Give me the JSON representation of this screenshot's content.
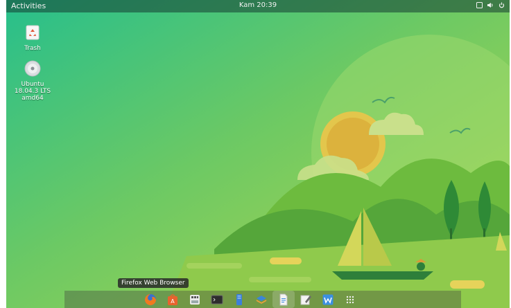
{
  "topbar": {
    "activities_label": "Activities",
    "clock_text": "Kam 20:39",
    "tray_icons": [
      "window-icon",
      "volume-icon",
      "power-icon"
    ]
  },
  "desktop": {
    "trash_label": "Trash",
    "disc_label_line1": "Ubuntu",
    "disc_label_line2": "18.04.3 LTS",
    "disc_label_line3": "amd64"
  },
  "dock": {
    "tooltip": "Firefox Web Browser",
    "items": [
      "firefox-icon",
      "software-store-icon",
      "app-3-icon",
      "terminal-icon",
      "files-icon",
      "layers-icon",
      "document-icon",
      "text-editor-icon",
      "app-9-icon",
      "show-applications-icon"
    ]
  },
  "colors": {
    "wallpaper_top": "#2fbf8a",
    "wallpaper_mid": "#8fd04a",
    "hill_dark": "#4aa63c",
    "accent_yellow": "#e8c845"
  }
}
